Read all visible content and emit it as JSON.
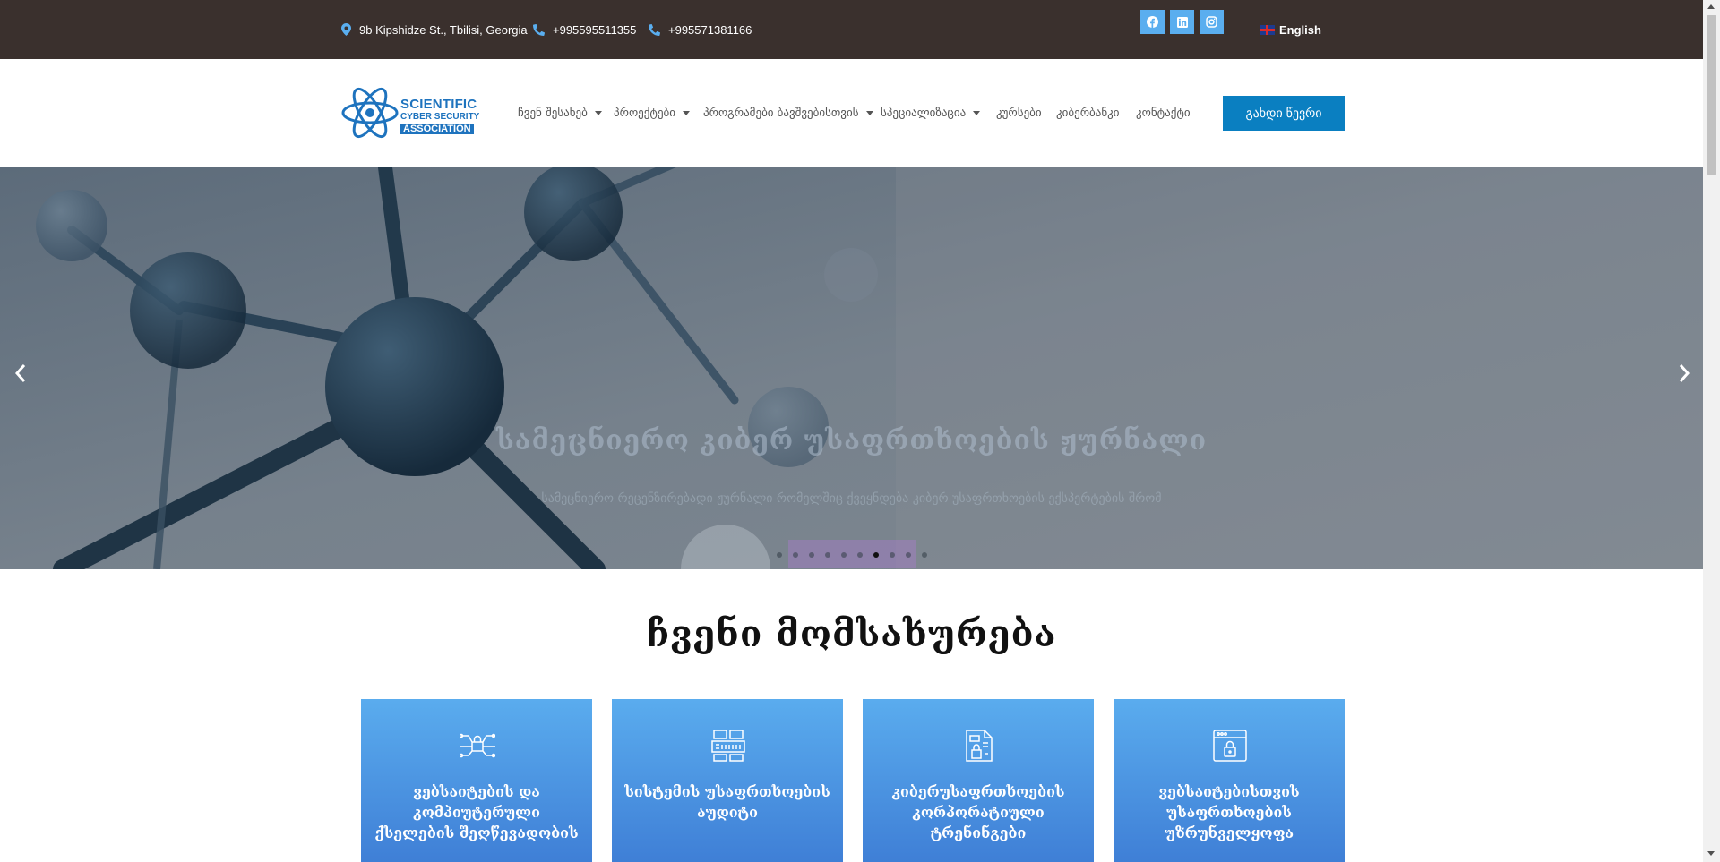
{
  "topbar": {
    "address": "9b Kipshidze St., Tbilisi, Georgia",
    "phone1": "+995595511355",
    "phone2": "+995571381166",
    "social": [
      "facebook-icon",
      "linkedin-icon",
      "instagram-icon"
    ],
    "language": "English"
  },
  "logo": {
    "line1": "SCIENTIFIC",
    "line2": "CYBER SECURITY",
    "line3": "ASSOCIATION"
  },
  "nav": {
    "items": [
      {
        "label": "ჩვენ შესახებ",
        "dropdown": true
      },
      {
        "label": "პროექტები",
        "dropdown": true
      },
      {
        "label": "პროგრამები ბავშვებისთვის",
        "dropdown": true
      },
      {
        "label": "სპეციალიზაცია",
        "dropdown": true
      },
      {
        "label": "კურსები",
        "dropdown": false
      },
      {
        "label": "კიბერბანკი",
        "dropdown": false
      },
      {
        "label": "კონტაქტი",
        "dropdown": false
      }
    ],
    "cta": "გახდი წევრი"
  },
  "hero": {
    "title": "სამეცნიერო კიბერ უსაფრთხოების ჟურნალი",
    "subtitle": "სამეცნიერო რეცენზირებადი ჟურნალი რომელშიც ქვეყნდება კიბერ უსაფრთხოების ექსპერტების შრომ",
    "slide_count": 10,
    "active_slide": 6
  },
  "services": {
    "title": "ჩვენი მომსახურება",
    "cards": [
      {
        "title": "ვებსაიტების და კომპიუტერული ქსელების შეღწევადობის",
        "icon": "network-lock-icon"
      },
      {
        "title": "სისტემის უსაფრთხოების აუდიტი",
        "icon": "server-audit-icon"
      },
      {
        "title": "კიბერუსაფრთხოების კორპორატიული ტრენინგები",
        "icon": "training-document-icon"
      },
      {
        "title": "ვებსაიტებისთვის უსაფრთხოების უზრუნველყოფა",
        "icon": "browser-lock-icon"
      }
    ]
  },
  "colors": {
    "topbar_bg": "#3a302d",
    "accent": "#0a7fc1",
    "social_bg": "#5aaeef",
    "card_gradient_top": "#5aacee",
    "card_gradient_bottom": "#3f7fd6"
  }
}
